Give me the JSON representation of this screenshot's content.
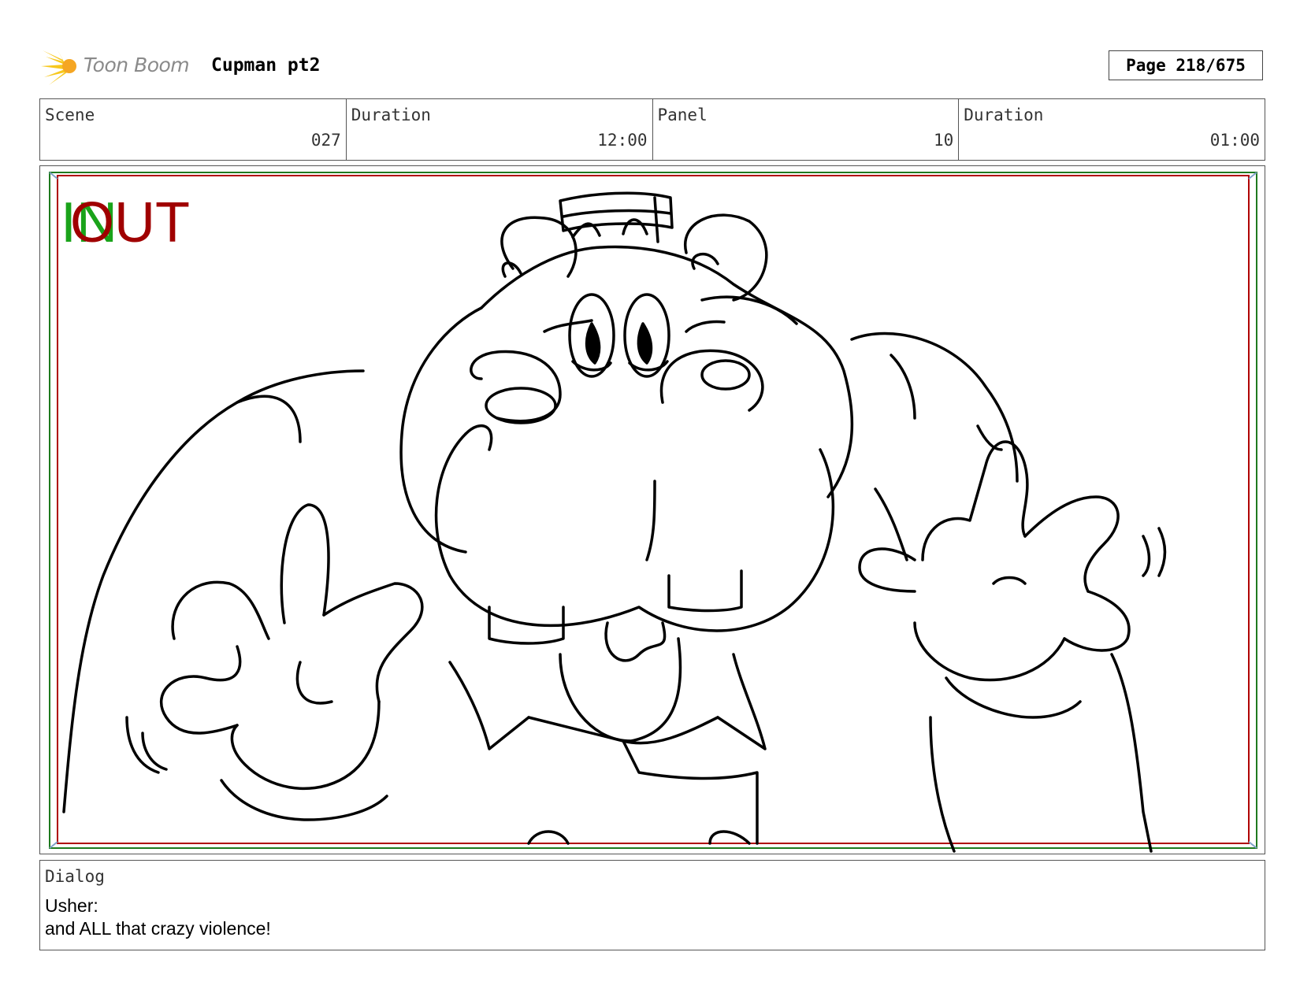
{
  "header": {
    "logo_text": "Toon Boom",
    "project_title": "Cupman pt2",
    "page_label": "Page 218/675"
  },
  "info": {
    "scene_label": "Scene",
    "scene_value": "027",
    "scene_duration_label": "Duration",
    "scene_duration_value": "12:00",
    "panel_label": "Panel",
    "panel_value": "10",
    "panel_duration_label": "Duration",
    "panel_duration_value": "01:00"
  },
  "panel": {
    "in_marker": "IN",
    "out_marker": "OUT",
    "in_color": "#1aa31a",
    "out_color": "#a00000"
  },
  "dialog": {
    "label": "Dialog",
    "speaker": "Usher:",
    "line": "and ALL that crazy violence!"
  }
}
